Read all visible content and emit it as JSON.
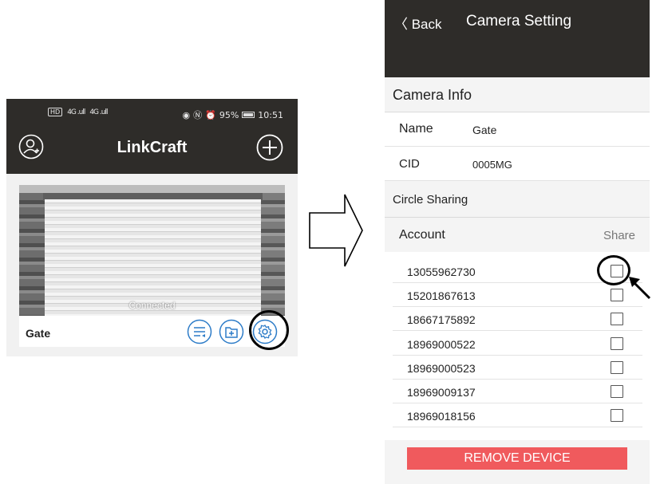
{
  "left_screen": {
    "status_bar": {
      "network": "HD",
      "signal_1": "4G .ull",
      "signal_2": "4G .ull",
      "battery": "95%",
      "time": "10:51"
    },
    "header": {
      "title": "LinkCraft",
      "user_icon": "user-add-icon",
      "add_icon": "plus-circle-icon"
    },
    "camera_card": {
      "name": "Gate",
      "status": "Connected",
      "buttons": [
        "playback-list-icon",
        "folder-add-icon",
        "settings-gear-icon"
      ]
    }
  },
  "right_screen": {
    "header": {
      "back_label": "〈 Back",
      "title": "Camera Setting"
    },
    "camera_info": {
      "section_label": "Camera Info",
      "name_label": "Name",
      "name_value": "Gate",
      "cid_label": "CID",
      "cid_value": "0005MG"
    },
    "circle_sharing": {
      "section_label": "Circle Sharing",
      "account_header": "Account",
      "share_header": "Share",
      "accounts": [
        {
          "number": "13055962730",
          "shared": false
        },
        {
          "number": "15201867613",
          "shared": false
        },
        {
          "number": "18667175892",
          "shared": false
        },
        {
          "number": "18969000522",
          "shared": false
        },
        {
          "number": "18969000523",
          "shared": false
        },
        {
          "number": "18969009137",
          "shared": false
        },
        {
          "number": "18969018156",
          "shared": false
        }
      ]
    },
    "remove_button": "REMOVE DEVICE"
  },
  "colors": {
    "header_bg": "#2e2c29",
    "accent_blue": "#2d7cc8",
    "remove_red": "#f05a5d"
  }
}
